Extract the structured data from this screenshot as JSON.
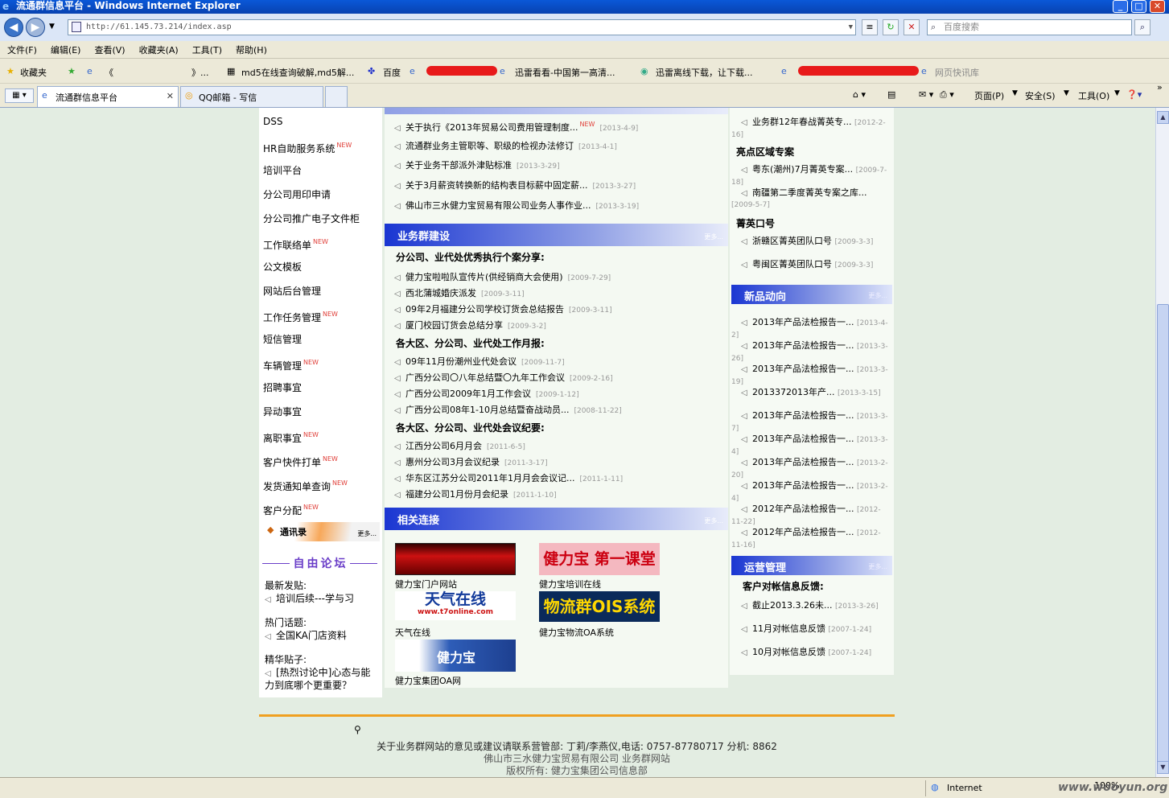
{
  "window": {
    "title": "流通群信息平台 - Windows Internet Explorer"
  },
  "address": {
    "url": "http://61.145.73.214/index.asp",
    "search_placeholder": "百度搜索"
  },
  "menu": [
    "文件(F)",
    "编辑(E)",
    "查看(V)",
    "收藏夹(A)",
    "工具(T)",
    "帮助(H)"
  ],
  "favorites": {
    "label": "收藏夹",
    "items": [
      "《",
      "》...",
      "md5在线查询破解,md5解...",
      "百度",
      "迅雷看看-中国第一高清...",
      "迅雷离线下载，让下载...",
      "网页快讯库"
    ]
  },
  "tabs": [
    {
      "label": "流通群信息平台"
    },
    {
      "label": "QQ邮箱 - 写信"
    }
  ],
  "commands": [
    "页面(P)",
    "安全(S)",
    "工具(O)"
  ],
  "left_menu": {
    "new_badge": "NEW",
    "items": [
      {
        "label": "DSS",
        "new": false
      },
      {
        "label": "HR自助服务系统",
        "new": true
      },
      {
        "label": "培训平台",
        "new": false
      },
      {
        "label": "分公司用印申请",
        "new": false
      },
      {
        "label": "分公司推广电子文件柜",
        "new": false
      },
      {
        "label": "工作联络单",
        "new": true
      },
      {
        "label": "公文模板",
        "new": false
      },
      {
        "label": "网站后台管理",
        "new": false
      },
      {
        "label": "工作任务管理",
        "new": true
      },
      {
        "label": "短信管理",
        "new": false
      },
      {
        "label": "车辆管理",
        "new": true
      },
      {
        "label": "招聘事宜",
        "new": false
      },
      {
        "label": "异动事宜",
        "new": false
      },
      {
        "label": "离职事宜",
        "new": true
      },
      {
        "label": "客户快件打单",
        "new": true
      },
      {
        "label": "发货通知单查询",
        "new": true
      },
      {
        "label": "客户分配",
        "new": true
      }
    ],
    "contacts": {
      "label": "通讯录",
      "more": "更多..."
    },
    "forum": {
      "title": "自由论坛",
      "latest_label": "最新发贴:",
      "latest": "培训后续---学与习",
      "hot_label": "热门话题:",
      "hot": "全国KA门店资料",
      "elite_label": "精华贴子:",
      "elite": "[热烈讨论中]心态与能力到底哪个更重要？"
    }
  },
  "center": {
    "notices": [
      {
        "title": "关于执行《2013年贸易公司费用管理制度...",
        "date": "[2013-4-9]",
        "new": true
      },
      {
        "title": "流通群业务主管职等、职级的检视办法修订",
        "date": "[2013-4-1]",
        "new": false
      },
      {
        "title": "关于业务干部派外津贴标准",
        "date": "[2013-3-29]",
        "new": false
      },
      {
        "title": "关于3月薪资转换新的结构表目标薪中固定薪...",
        "date": "[2013-3-27]",
        "new": false
      },
      {
        "title": "佛山市三水健力宝贸易有限公司业务人事作业...",
        "date": "[2013-3-19]",
        "new": false
      }
    ],
    "new_badge": "NEW",
    "build": {
      "title": "业务群建设",
      "more": "更多...",
      "sections": [
        {
          "heading": "分公司、业代处优秀执行个案分享:",
          "items": [
            {
              "title": "健力宝啦啦队宣传片(供经销商大会使用)",
              "date": "[2009-7-29]"
            },
            {
              "title": "西北蒲城婚庆派发",
              "date": "[2009-3-11]"
            },
            {
              "title": "09年2月福建分公司学校订货会总结报告",
              "date": "[2009-3-11]"
            },
            {
              "title": "厦门校园订货会总结分享",
              "date": "[2009-3-2]"
            }
          ]
        },
        {
          "heading": "各大区、分公司、业代处工作月报:",
          "items": [
            {
              "title": "09年11月份潮州业代处会议",
              "date": "[2009-11-7]"
            },
            {
              "title": "广西分公司〇八年总结暨〇九年工作会议",
              "date": "[2009-2-16]"
            },
            {
              "title": "广西分公司2009年1月工作会议",
              "date": "[2009-1-12]"
            },
            {
              "title": "广西分公司08年1-10月总结暨奋战动员...",
              "date": "[2008-11-22]"
            }
          ]
        },
        {
          "heading": "各大区、分公司、业代处会议纪要:",
          "items": [
            {
              "title": "江西分公司6月月会",
              "date": "[2011-6-5]"
            },
            {
              "title": "惠州分公司3月会议纪录",
              "date": "[2011-3-17]"
            },
            {
              "title": "华东区江苏分公司2011年1月月会会议记...",
              "date": "[2011-1-11]"
            },
            {
              "title": "福建分公司1月份月会纪录",
              "date": "[2011-1-10]"
            }
          ]
        }
      ]
    },
    "links": {
      "title": "相关连接",
      "more": "更多...",
      "items": [
        {
          "caption": "健力宝门户网站",
          "logo": ""
        },
        {
          "caption": "健力宝培训在线",
          "logo": "健力宝 第一课堂"
        },
        {
          "caption": "天气在线",
          "logo": "天气在线",
          "logo_sub": "www.t7online.com"
        },
        {
          "caption": "健力宝物流OA系统",
          "logo": "物流群OIS系统"
        },
        {
          "caption": "健力宝集团OA网",
          "logo": "健力宝"
        }
      ]
    }
  },
  "right": {
    "top_items": [
      {
        "title": "业务群12年春战菁英专...",
        "date": "[2012-2-16]"
      }
    ],
    "highlight": {
      "heading": "亮点区域专案",
      "items": [
        {
          "title": "粤东(潮州)7月菁英专案...",
          "date": "[2009-7-18]"
        },
        {
          "title": "南疆第二季度菁英专案之库...",
          "date": "[2009-5-7]"
        }
      ]
    },
    "slogan": {
      "heading": "菁英口号",
      "items": [
        {
          "title": "浙赣区菁英团队口号",
          "date": "[2009-3-3]"
        },
        {
          "title": "粤闽区菁英团队口号",
          "date": "[2009-3-3]"
        }
      ]
    },
    "products": {
      "title": "新品动向",
      "more": "更多...",
      "items": [
        {
          "title": "2013年产品法检报告一...",
          "date": "[2013-4-2]"
        },
        {
          "title": "2013年产品法检报告一...",
          "date": "[2013-3-26]"
        },
        {
          "title": "2013年产品法检报告一...",
          "date": "[2013-3-19]"
        },
        {
          "title": "2013372013年产...",
          "date": "[2013-3-15]"
        },
        {
          "title": "2013年产品法检报告一...",
          "date": "[2013-3-7]"
        },
        {
          "title": "2013年产品法检报告一...",
          "date": "[2013-3-4]"
        },
        {
          "title": "2013年产品法检报告一...",
          "date": "[2013-2-20]"
        },
        {
          "title": "2013年产品法检报告一...",
          "date": "[2013-2-4]"
        },
        {
          "title": "2012年产品法检报告一...",
          "date": "[2012-11-22]"
        },
        {
          "title": "2012年产品法检报告一...",
          "date": "[2012-11-16]"
        }
      ]
    },
    "ops": {
      "title": "运营管理",
      "more": "更多...",
      "heading": "客户对帐信息反馈:",
      "items": [
        {
          "title": "截止2013.3.26未...",
          "date": "[2013-3-26]"
        },
        {
          "title": "11月对帐信息反馈",
          "date": "[2007-1-24]"
        },
        {
          "title": "10月对帐信息反馈",
          "date": "[2007-1-24]"
        }
      ]
    }
  },
  "footer": {
    "contact": "关于业务群网站的意见或建议请联系营管部: 丁莉/李燕仪,电话: 0757-87780717 分机: 8862",
    "company": "佛山市三水健力宝贸易有限公司 业务群网站",
    "copyright": "版权所有: 健力宝集团公司信息部"
  },
  "status": {
    "zone": "Internet",
    "zoom": "100%",
    "watermark": "www.wooyun.org"
  }
}
